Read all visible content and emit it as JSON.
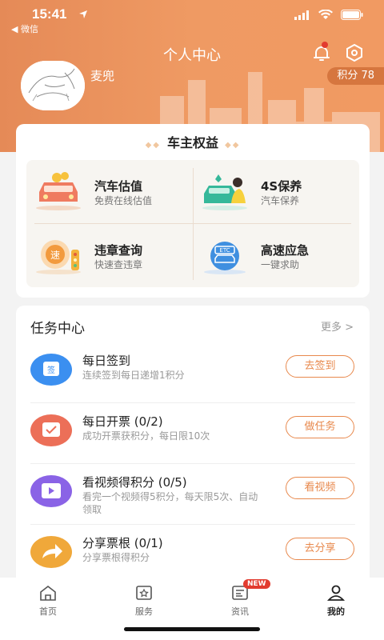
{
  "status_bar": {
    "time": "15:41",
    "back_label": "◀ 微信"
  },
  "header": {
    "title": "个人中心",
    "username": "麦兜",
    "points": "积分 78"
  },
  "benefits": {
    "title": "车主权益",
    "items": [
      {
        "title": "汽车估值",
        "subtitle": "免费在线估值",
        "icon": "car-valuation-icon"
      },
      {
        "title": "4S保养",
        "subtitle": "汽车保养",
        "icon": "car-maintenance-icon"
      },
      {
        "title": "违章查询",
        "subtitle": "快速查违章",
        "icon": "violation-query-icon"
      },
      {
        "title": "高速应急",
        "subtitle": "一键求助",
        "icon": "etc-highway-icon"
      }
    ]
  },
  "tasks": {
    "title": "任务中心",
    "more": "更多 >",
    "items": [
      {
        "name": "每日签到",
        "desc": "连续签到每日递增1积分",
        "button": "去签到",
        "icon": "calendar-sign-icon",
        "color": "#3b8ff0"
      },
      {
        "name": "每日开票 (0/2)",
        "desc": "成功开票获积分，每日限10次",
        "button": "做任务",
        "icon": "invoice-icon",
        "color": "#ec6f58"
      },
      {
        "name": "看视频得积分 (0/5)",
        "desc": "看完一个视频得5积分，每天限5次、自动领取",
        "button": "看视频",
        "icon": "video-icon",
        "color": "#8a63e6"
      },
      {
        "name": "分享票根 (0/1)",
        "desc": "分享票根得积分",
        "button": "去分享",
        "icon": "share-icon",
        "color": "#f0a83a"
      }
    ]
  },
  "tabbar": {
    "items": [
      {
        "label": "首页",
        "icon": "home-icon"
      },
      {
        "label": "服务",
        "icon": "service-icon"
      },
      {
        "label": "资讯",
        "icon": "news-icon",
        "badge": "NEW"
      },
      {
        "label": "我的",
        "icon": "profile-icon",
        "active": true
      }
    ]
  }
}
